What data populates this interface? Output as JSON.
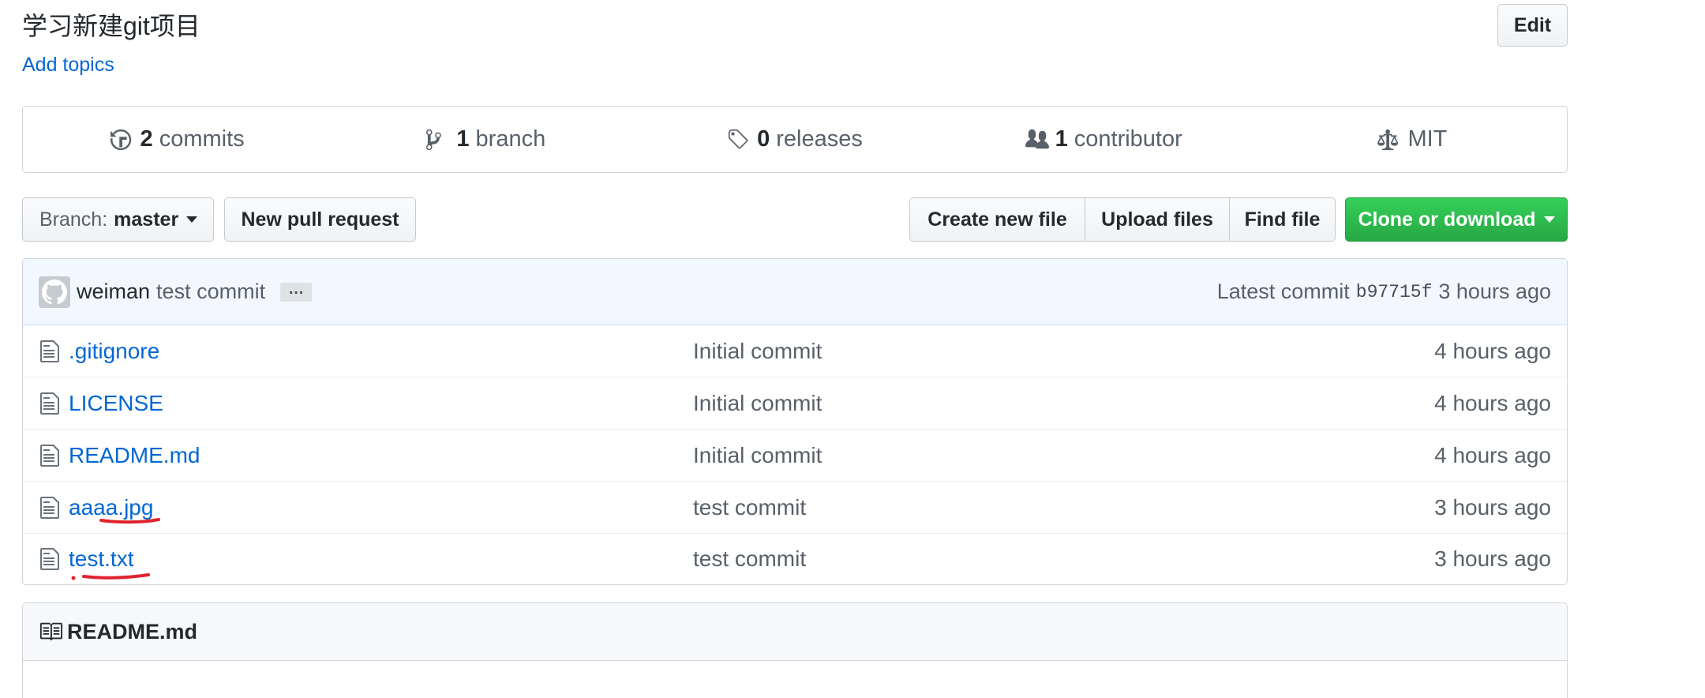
{
  "repo": {
    "description": "学习新建git项目",
    "add_topics_label": "Add topics",
    "edit_label": "Edit"
  },
  "summary": {
    "commits": {
      "count": "2",
      "label": "commits",
      "icon": "history-icon"
    },
    "branches": {
      "count": "1",
      "label": "branch",
      "icon": "git-branch-icon"
    },
    "releases": {
      "count": "0",
      "label": "releases",
      "icon": "tag-icon"
    },
    "contributors": {
      "count": "1",
      "label": "contributor",
      "icon": "people-icon"
    },
    "license": {
      "label": "MIT",
      "icon": "law-icon"
    }
  },
  "toolbar": {
    "branch_prefix": "Branch:",
    "branch_name": "master",
    "new_pr_label": "New pull request",
    "create_file_label": "Create new file",
    "upload_files_label": "Upload files",
    "find_file_label": "Find file",
    "clone_label": "Clone or download"
  },
  "latest_commit": {
    "author": "weiman",
    "message": "test commit",
    "ellipsis": "…",
    "prefix": "Latest commit",
    "sha": "b97715f",
    "time": "3 hours ago"
  },
  "files": [
    {
      "name": ".gitignore",
      "message": "Initial commit",
      "age": "4 hours ago",
      "icon": "file-icon"
    },
    {
      "name": "LICENSE",
      "message": "Initial commit",
      "age": "4 hours ago",
      "icon": "file-icon"
    },
    {
      "name": "README.md",
      "message": "Initial commit",
      "age": "4 hours ago",
      "icon": "file-icon"
    },
    {
      "name": "aaaa.jpg",
      "message": "test commit",
      "age": "3 hours ago",
      "icon": "file-icon"
    },
    {
      "name": "test.txt",
      "message": "test commit",
      "age": "3 hours ago",
      "icon": "file-icon"
    }
  ],
  "readme": {
    "title": "README.md",
    "icon": "book-icon"
  },
  "colors": {
    "link": "#0366d6",
    "primary_green": "#28a745",
    "annotation_red": "#e0242f",
    "commit_tease_bg": "#f1f8ff"
  }
}
